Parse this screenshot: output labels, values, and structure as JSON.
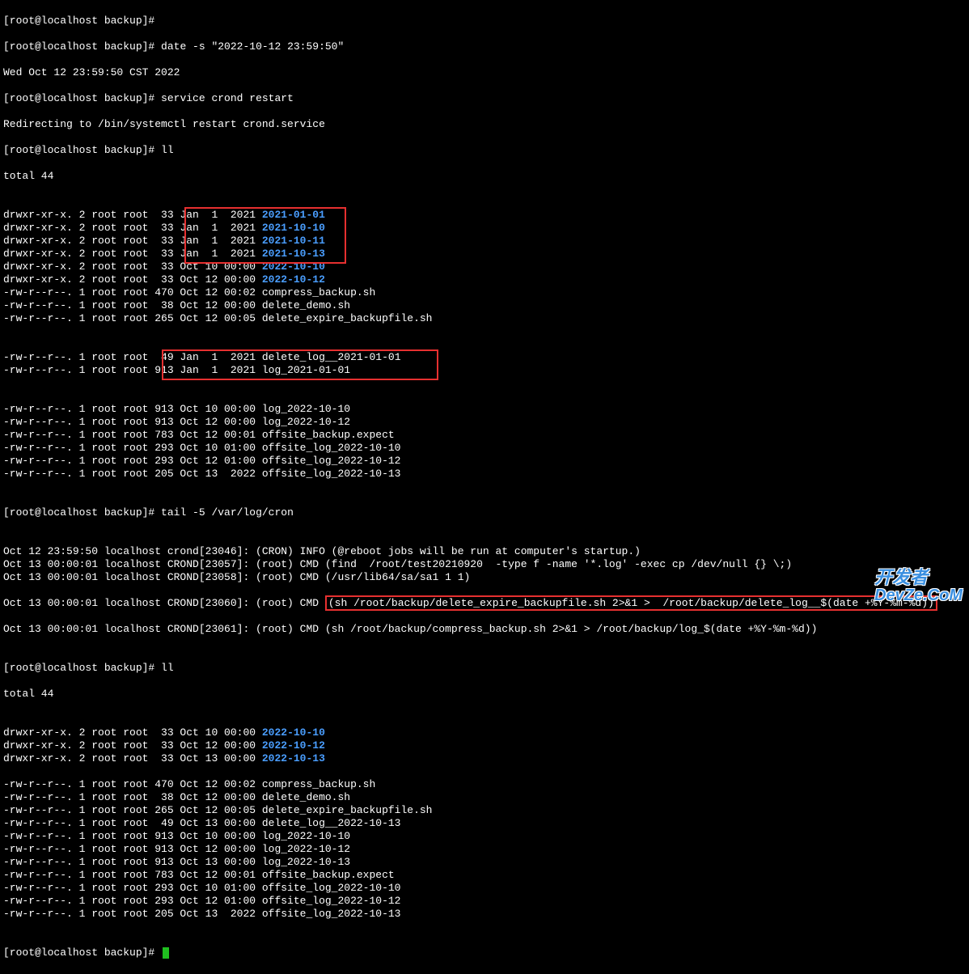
{
  "prompt": "[root@localhost backup]# ",
  "cmd_empty": "",
  "cmd_date": "date -s \"2022-10-12 23:59:50\"",
  "date_out": "Wed Oct 12 23:59:50 CST 2022",
  "cmd_service": "service crond restart",
  "service_out": "Redirecting to /bin/systemctl restart crond.service",
  "cmd_ll": "ll",
  "total": "total 44",
  "ll1": [
    {
      "perm": "drwxr-xr-x. 2 root root  33 ",
      "date": "Jan  1  2021 ",
      "name": "2021-01-01",
      "dir": true,
      "boxed": true
    },
    {
      "perm": "drwxr-xr-x. 2 root root  33 ",
      "date": "Jan  1  2021 ",
      "name": "2021-10-10",
      "dir": true,
      "boxed": true
    },
    {
      "perm": "drwxr-xr-x. 2 root root  33 ",
      "date": "Jan  1  2021 ",
      "name": "2021-10-11",
      "dir": true,
      "boxed": true
    },
    {
      "perm": "drwxr-xr-x. 2 root root  33 ",
      "date": "Jan  1  2021 ",
      "name": "2021-10-13",
      "dir": true,
      "boxed": true
    },
    {
      "perm": "drwxr-xr-x. 2 root root  33 Oct 10 00:00 ",
      "date": "",
      "name": "2022-10-10",
      "dir": true,
      "boxed": false
    },
    {
      "perm": "drwxr-xr-x. 2 root root  33 Oct 12 00:00 ",
      "date": "",
      "name": "2022-10-12",
      "dir": true,
      "boxed": false
    },
    {
      "perm": "-rw-r--r--. 1 root root 470 Oct 12 00:02 compress_backup.sh",
      "date": "",
      "name": "",
      "dir": false,
      "boxed": false
    },
    {
      "perm": "-rw-r--r--. 1 root root  38 Oct 12 00:00 delete_demo.sh",
      "date": "",
      "name": "",
      "dir": false,
      "boxed": false
    },
    {
      "perm": "-rw-r--r--. 1 root root 265 Oct 12 00:05 delete_expire_backupfile.sh",
      "date": "",
      "name": "",
      "dir": false,
      "boxed": false
    }
  ],
  "ll1_box2": [
    {
      "pre": "-rw-r--r--. 1 root root  ",
      "in": "49 Jan  1  2021 delete_log__2021-01-01"
    },
    {
      "pre": "-rw-r--r--. 1 root root 9",
      "in": "13 Jan  1  2021 log_2021-01-01        "
    }
  ],
  "ll1_rest": [
    "-rw-r--r--. 1 root root 913 Oct 10 00:00 log_2022-10-10",
    "-rw-r--r--. 1 root root 913 Oct 12 00:00 log_2022-10-12",
    "-rw-r--r--. 1 root root 783 Oct 12 00:01 offsite_backup.expect",
    "-rw-r--r--. 1 root root 293 Oct 10 01:00 offsite_log_2022-10-10",
    "-rw-r--r--. 1 root root 293 Oct 12 01:00 offsite_log_2022-10-12",
    "-rw-r--r--. 1 root root 205 Oct 13  2022 offsite_log_2022-10-13"
  ],
  "cmd_tail": "tail -5 /var/log/cron",
  "cron_lines": [
    "Oct 12 23:59:50 localhost crond[23046]: (CRON) INFO (@reboot jobs will be run at computer's startup.)",
    "Oct 13 00:00:01 localhost CROND[23057]: (root) CMD (find  /root/test20210920  -type f -name '*.log' -exec cp /dev/null {} \\;)",
    "Oct 13 00:00:01 localhost CROND[23058]: (root) CMD (/usr/lib64/sa/sa1 1 1)"
  ],
  "cron_boxed_line": {
    "pre": "Oct 13 00:00:01 localhost CROND[23060]: (root) CMD ",
    "box": "(sh /root/backup/delete_expire_backupfile.sh 2>&1 >  /root/backup/delete_log__$(date +%Y-%m-%d))"
  },
  "cron_after": "Oct 13 00:00:01 localhost CROND[23061]: (root) CMD (sh /root/backup/compress_backup.sh 2>&1 > /root/backup/log_$(date +%Y-%m-%d))",
  "ll2_dirs": [
    {
      "pre": "drwxr-xr-x. 2 root root  33 Oct 10 00:00 ",
      "name": "2022-10-10"
    },
    {
      "pre": "drwxr-xr-x. 2 root root  33 Oct 12 00:00 ",
      "name": "2022-10-12"
    },
    {
      "pre": "drwxr-xr-x. 2 root root  33 Oct 13 00:00 ",
      "name": "2022-10-13"
    }
  ],
  "ll2_files": [
    "-rw-r--r--. 1 root root 470 Oct 12 00:02 compress_backup.sh",
    "-rw-r--r--. 1 root root  38 Oct 12 00:00 delete_demo.sh",
    "-rw-r--r--. 1 root root 265 Oct 12 00:05 delete_expire_backupfile.sh",
    "-rw-r--r--. 1 root root  49 Oct 13 00:00 delete_log__2022-10-13",
    "-rw-r--r--. 1 root root 913 Oct 10 00:00 log_2022-10-10",
    "-rw-r--r--. 1 root root 913 Oct 12 00:00 log_2022-10-12",
    "-rw-r--r--. 1 root root 913 Oct 13 00:00 log_2022-10-13",
    "-rw-r--r--. 1 root root 783 Oct 12 00:01 offsite_backup.expect",
    "-rw-r--r--. 1 root root 293 Oct 10 01:00 offsite_log_2022-10-10",
    "-rw-r--r--. 1 root root 293 Oct 12 01:00 offsite_log_2022-10-12",
    "-rw-r--r--. 1 root root 205 Oct 13  2022 offsite_log_2022-10-13"
  ],
  "watermark": {
    "line1": "开发者",
    "line2": "DevZe.CoM"
  }
}
